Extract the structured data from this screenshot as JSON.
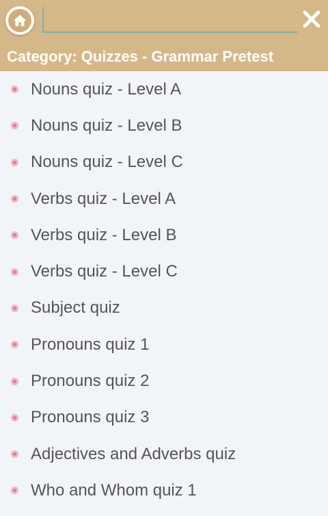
{
  "header": {
    "search": {
      "value": "",
      "placeholder": ""
    },
    "category_text": "Category: Quizzes - Grammar Pretest"
  },
  "colors": {
    "header_bg": "#d5b888",
    "list_bg": "#f1f4f8",
    "bullet": "#e57a89"
  },
  "icons": {
    "home": "home-icon",
    "close": "close-icon",
    "bullet": "bullet-icon"
  },
  "list": {
    "items": [
      {
        "label": "Nouns quiz - Level A"
      },
      {
        "label": "Nouns quiz - Level B"
      },
      {
        "label": "Nouns quiz - Level C"
      },
      {
        "label": "Verbs quiz - Level A"
      },
      {
        "label": "Verbs quiz - Level B"
      },
      {
        "label": "Verbs quiz - Level C"
      },
      {
        "label": "Subject quiz"
      },
      {
        "label": "Pronouns quiz 1"
      },
      {
        "label": "Pronouns quiz 2"
      },
      {
        "label": "Pronouns quiz 3"
      },
      {
        "label": "Adjectives and Adverbs quiz"
      },
      {
        "label": "Who and Whom quiz 1"
      }
    ]
  }
}
